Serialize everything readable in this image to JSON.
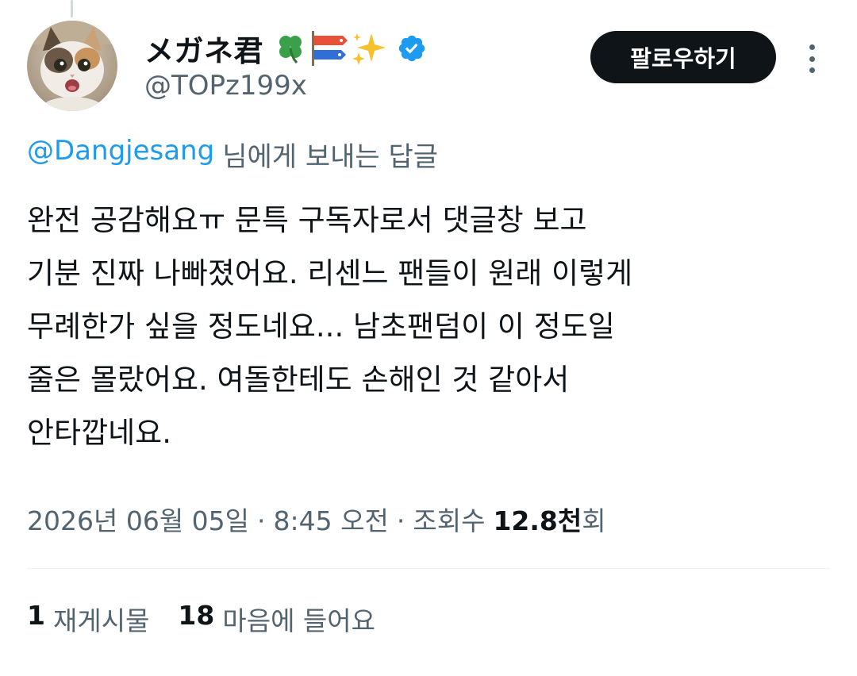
{
  "tweet": {
    "author": {
      "display_name": "メガネ君",
      "name_emojis": "🍀🎏✨",
      "handle": "@TOPz199x",
      "verified": true
    },
    "follow_label": "팔로우하기",
    "reply_to": {
      "mention": "@Dangjesang",
      "suffix": "님에게 보내는 답글"
    },
    "text_lines": [
      "완전 공감해요ㅠ 문특 구독자로서 댓글창 보고",
      "기분 진짜 나빠졌어요. 리센느 팬들이 원래 이렇게",
      "무례한가 싶을 정도네요... 남초팬덤이 이 정도일",
      "줄은 몰랐어요. 여돌한테도 손해인 것 같아서",
      "안타깝네요."
    ],
    "meta": {
      "date": "2026년 06월 05일",
      "sep1": "·",
      "time": "8:45 오전",
      "sep2": "·",
      "views_label": "조회수",
      "views_count": "12.8천",
      "views_unit": "회"
    },
    "stats": {
      "reposts_count": "1",
      "reposts_label": "재게시물",
      "likes_count": "18",
      "likes_label": "마음에 들어요"
    }
  },
  "colors": {
    "text": "#0f1419",
    "secondary": "#536471",
    "link": "#1d9bf0",
    "verified": "#1d9bf0",
    "button_bg": "#0f1419",
    "divider": "#eff3f4"
  }
}
